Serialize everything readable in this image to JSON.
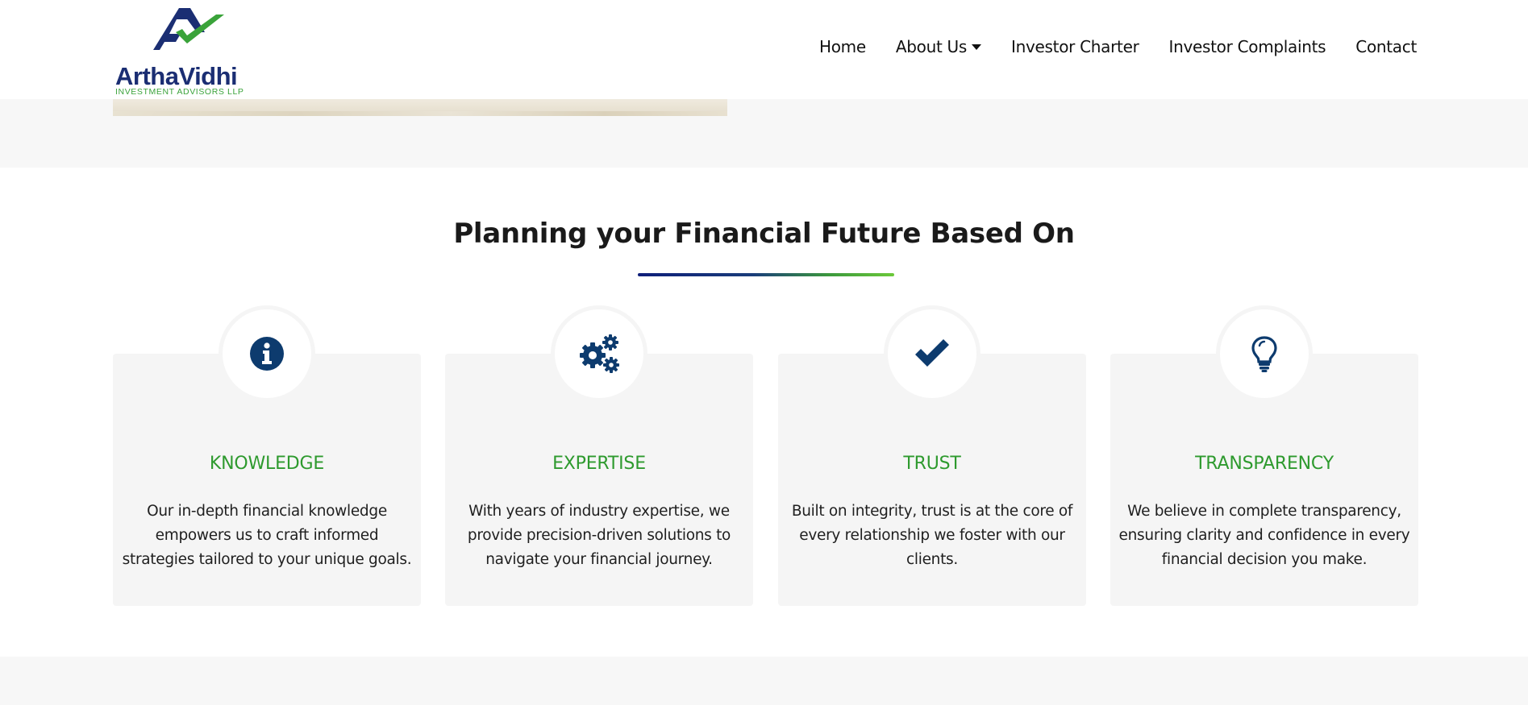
{
  "brand": {
    "name": "ArthaVidhi",
    "tagline": "INVESTMENT ADVISORS LLP"
  },
  "nav": {
    "items": [
      {
        "label": "Home"
      },
      {
        "label": "About Us",
        "dropdown": true
      },
      {
        "label": "Investor Charter"
      },
      {
        "label": "Investor Complaints"
      },
      {
        "label": "Contact"
      }
    ]
  },
  "section": {
    "title": "Planning your Financial Future Based On"
  },
  "features": [
    {
      "icon": "info-circle-icon",
      "title": "KNOWLEDGE",
      "text": "Our in-depth financial knowledge empowers us to craft informed strategies tailored to your unique goals."
    },
    {
      "icon": "gears-icon",
      "title": "EXPERTISE",
      "text": "With years of industry expertise, we provide precision-driven solutions to navigate your financial journey."
    },
    {
      "icon": "check-icon",
      "title": "TRUST",
      "text": "Built on integrity, trust is at the core of every relationship we foster with our clients."
    },
    {
      "icon": "lightbulb-icon",
      "title": "TRANSPARENCY",
      "text": "We believe in complete transparency, ensuring clarity and confidence in every financial decision you make."
    }
  ],
  "colors": {
    "brand_navy": "#1b2e73",
    "brand_green": "#3aa33a",
    "icon_blue": "#0d3b6e",
    "feature_title_green": "#2e9a2e",
    "card_bg": "#f5f5f5"
  }
}
